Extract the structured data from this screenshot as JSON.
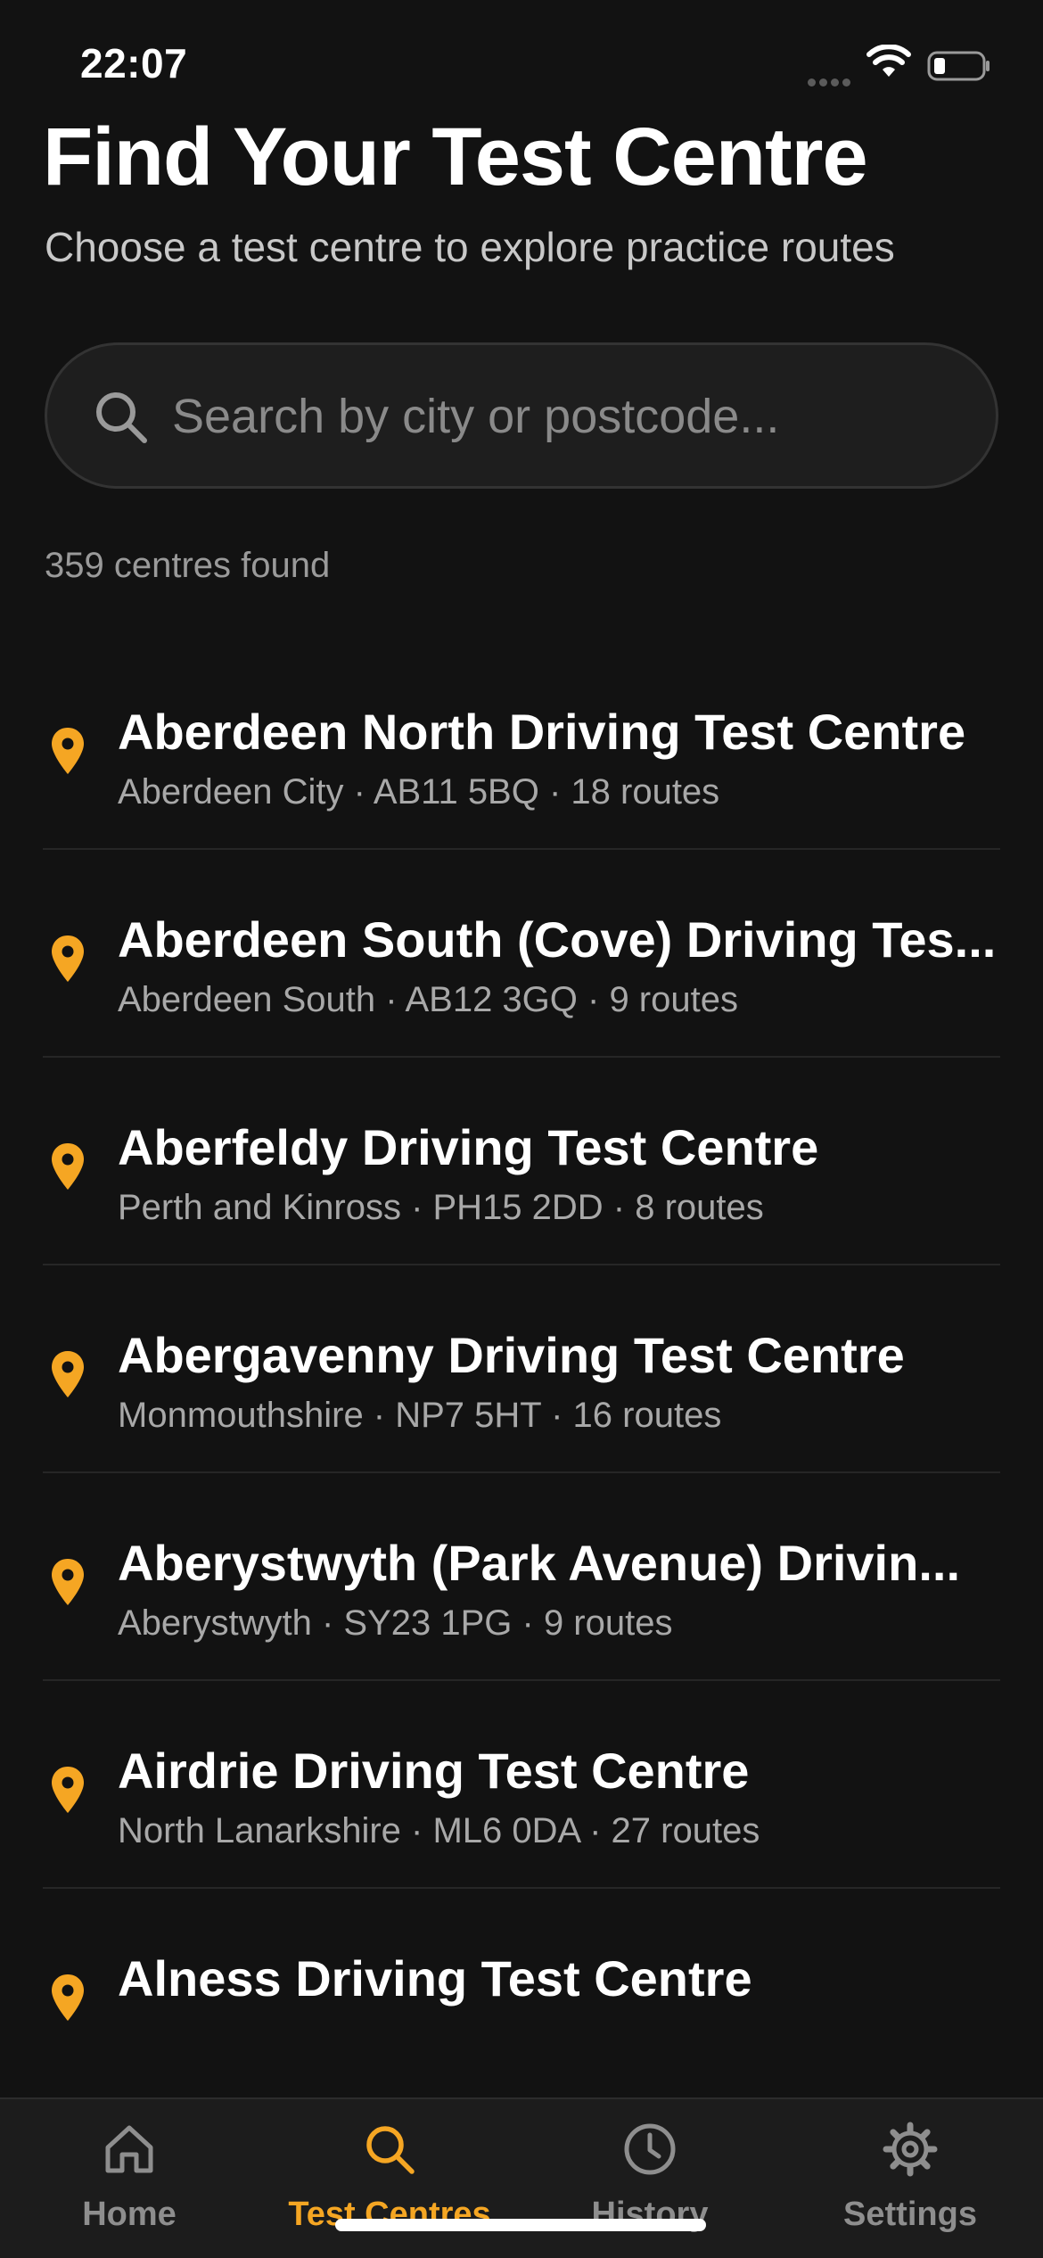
{
  "status_bar": {
    "time": "22:07"
  },
  "header": {
    "title": "Find Your Test Centre",
    "subtitle": "Choose a test centre to explore practice routes"
  },
  "search": {
    "placeholder": "Search by city or postcode...",
    "value": ""
  },
  "results": {
    "count_text": "359 centres found"
  },
  "centres": [
    {
      "name": "Aberdeen North Driving Test Centre",
      "meta": "Aberdeen City · AB11 5BQ · 18 routes"
    },
    {
      "name": "Aberdeen South (Cove) Driving Tes...",
      "meta": "Aberdeen South · AB12 3GQ · 9 routes"
    },
    {
      "name": "Aberfeldy Driving Test Centre",
      "meta": "Perth and Kinross · PH15 2DD · 8 routes"
    },
    {
      "name": "Abergavenny Driving Test Centre",
      "meta": "Monmouthshire · NP7 5HT · 16 routes"
    },
    {
      "name": "Aberystwyth (Park Avenue) Drivin...",
      "meta": "Aberystwyth · SY23 1PG · 9 routes"
    },
    {
      "name": "Airdrie Driving Test Centre",
      "meta": "North Lanarkshire · ML6 0DA · 27 routes"
    },
    {
      "name": "Alness Driving Test Centre",
      "meta": ""
    }
  ],
  "tabs": [
    {
      "label": "Home",
      "icon": "home-icon",
      "active": false
    },
    {
      "label": "Test Centres",
      "icon": "search-icon",
      "active": true
    },
    {
      "label": "History",
      "icon": "clock-icon",
      "active": false
    },
    {
      "label": "Settings",
      "icon": "gear-icon",
      "active": false
    }
  ],
  "colors": {
    "background": "#121212",
    "accent": "#f5a623",
    "text_primary": "#ffffff",
    "text_secondary": "#a8a8a8"
  }
}
